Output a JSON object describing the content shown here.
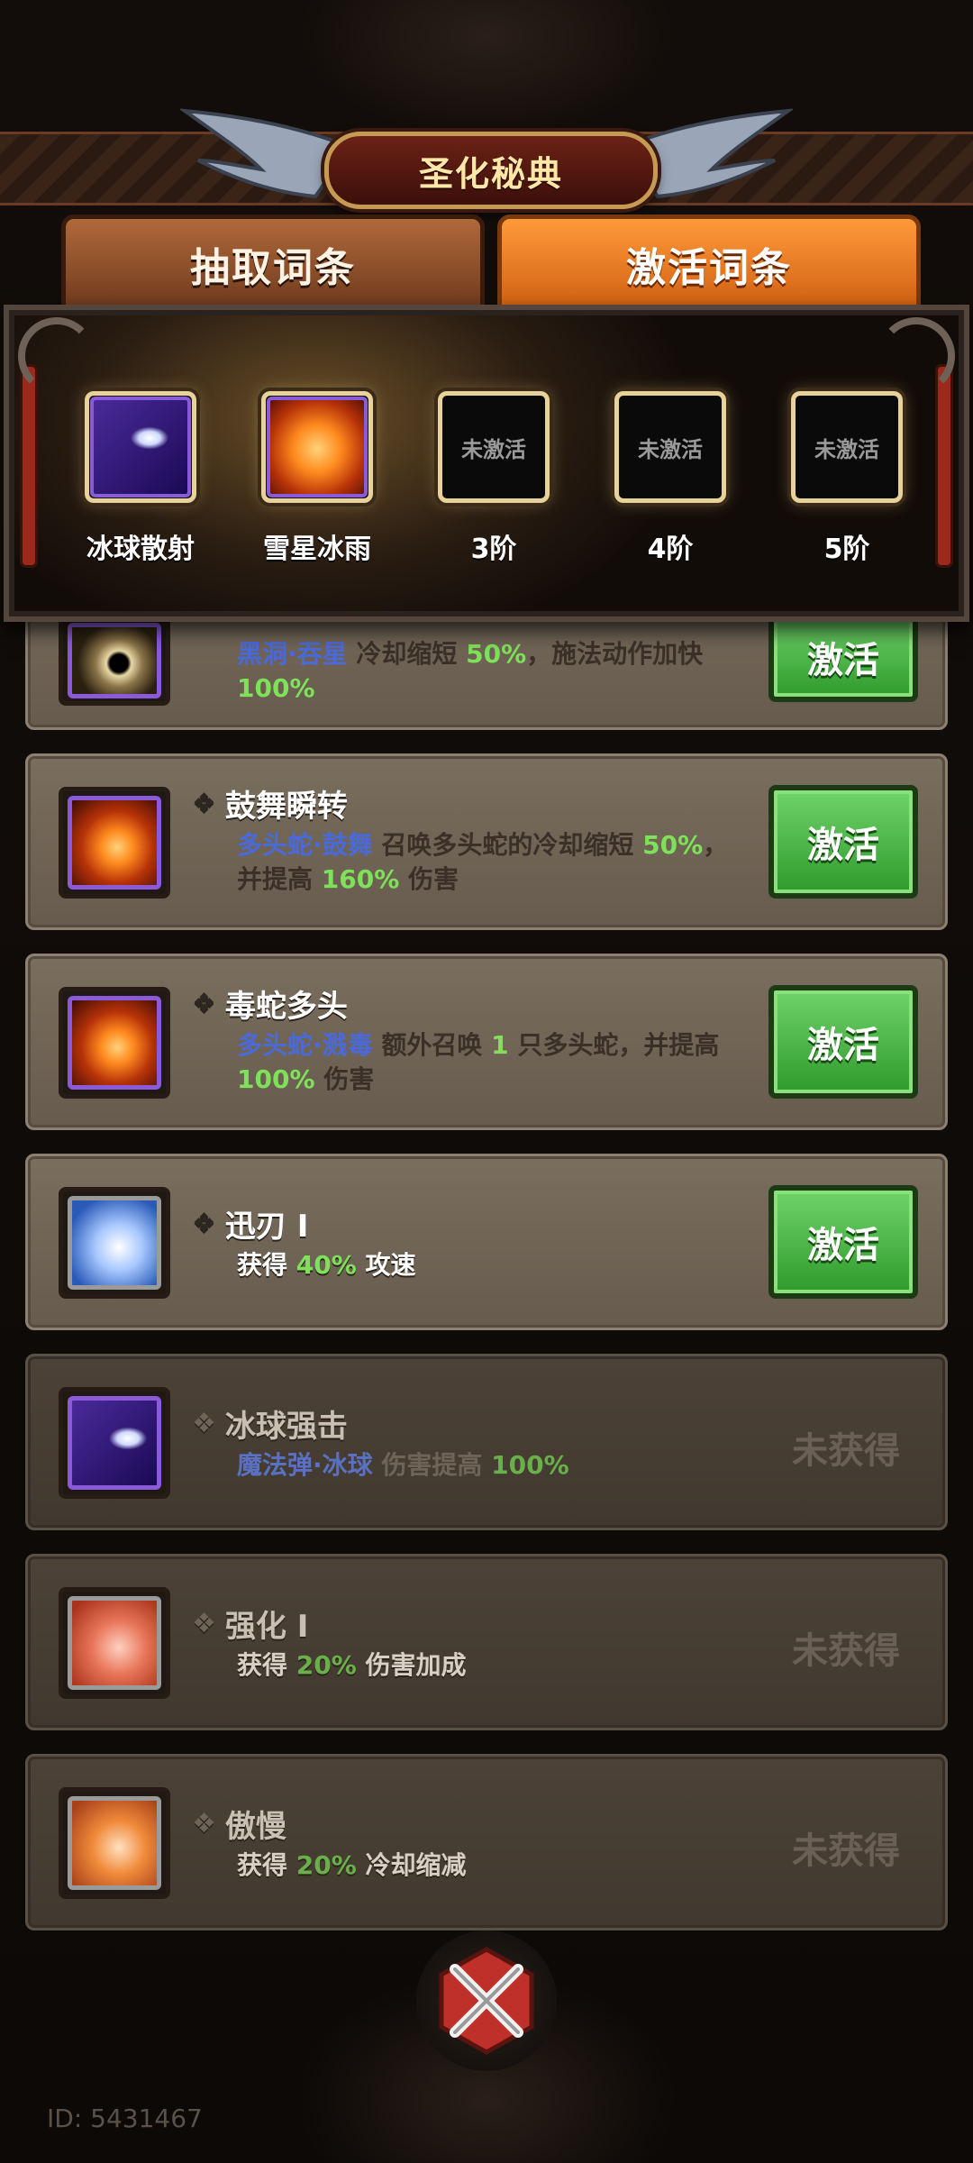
{
  "header": {
    "title": "圣化秘典"
  },
  "tabs": [
    {
      "label": "抽取词条",
      "active": false
    },
    {
      "label": "激活词条",
      "active": true
    }
  ],
  "slots": [
    {
      "label": "冰球散射",
      "state": "filled",
      "icon": "ice-ball-icon"
    },
    {
      "label": "雪星冰雨",
      "state": "filled",
      "icon": "fire-meteor-icon"
    },
    {
      "label": "3阶",
      "state": "locked",
      "locked_text": "未激活"
    },
    {
      "label": "4阶",
      "state": "locked",
      "locked_text": "未激活"
    },
    {
      "label": "5阶",
      "state": "locked",
      "locked_text": "未激活"
    }
  ],
  "skills": [
    {
      "icon": "black-hole-icon",
      "title": "",
      "desc_tag": "黑洞·吞星",
      "desc_p1": " 冷却缩短 ",
      "desc_n1": "50%",
      "desc_p2": "，施法动作加快 ",
      "desc_n2": "100%",
      "desc_p3": "",
      "button": "激活"
    },
    {
      "icon": "hydra-icon",
      "title": "鼓舞瞬转",
      "desc_tag": "多头蛇·鼓舞",
      "desc_p1": " 召唤多头蛇的冷却缩短 ",
      "desc_n1": "50%",
      "desc_p2": "，并提高 ",
      "desc_n2": "160%",
      "desc_p3": " 伤害",
      "button": "激活"
    },
    {
      "icon": "hydra-icon",
      "title": "毒蛇多头",
      "desc_tag": "多头蛇·溅毒",
      "desc_p1": " 额外召唤 ",
      "desc_n1": "1",
      "desc_p2": " 只多头蛇，并提高 ",
      "desc_n2": "100%",
      "desc_p3": " 伤害",
      "button": "激活"
    },
    {
      "icon": "swift-blade-icon",
      "title": "迅刃 I",
      "desc_pre": "获得 ",
      "desc_n1": "40%",
      "desc_post": " 攻速",
      "button": "激活"
    },
    {
      "icon": "ice-ball-icon",
      "title": "冰球强击",
      "desc_tag": "魔法弹·冰球",
      "desc_p1": " 伤害提高 ",
      "desc_n1": "100%",
      "status": "未获得"
    },
    {
      "icon": "power-icon",
      "title": "强化 I",
      "desc_pre": "获得 ",
      "desc_n1": "20%",
      "desc_post": " 伤害加成",
      "status": "未获得"
    },
    {
      "icon": "pride-shield-icon",
      "title": "傲慢",
      "desc_pre": "获得 ",
      "desc_n1": "20%",
      "desc_post": " 冷却缩减",
      "status": "未获得"
    }
  ],
  "footer": {
    "id_text": "ID: 5431467"
  }
}
